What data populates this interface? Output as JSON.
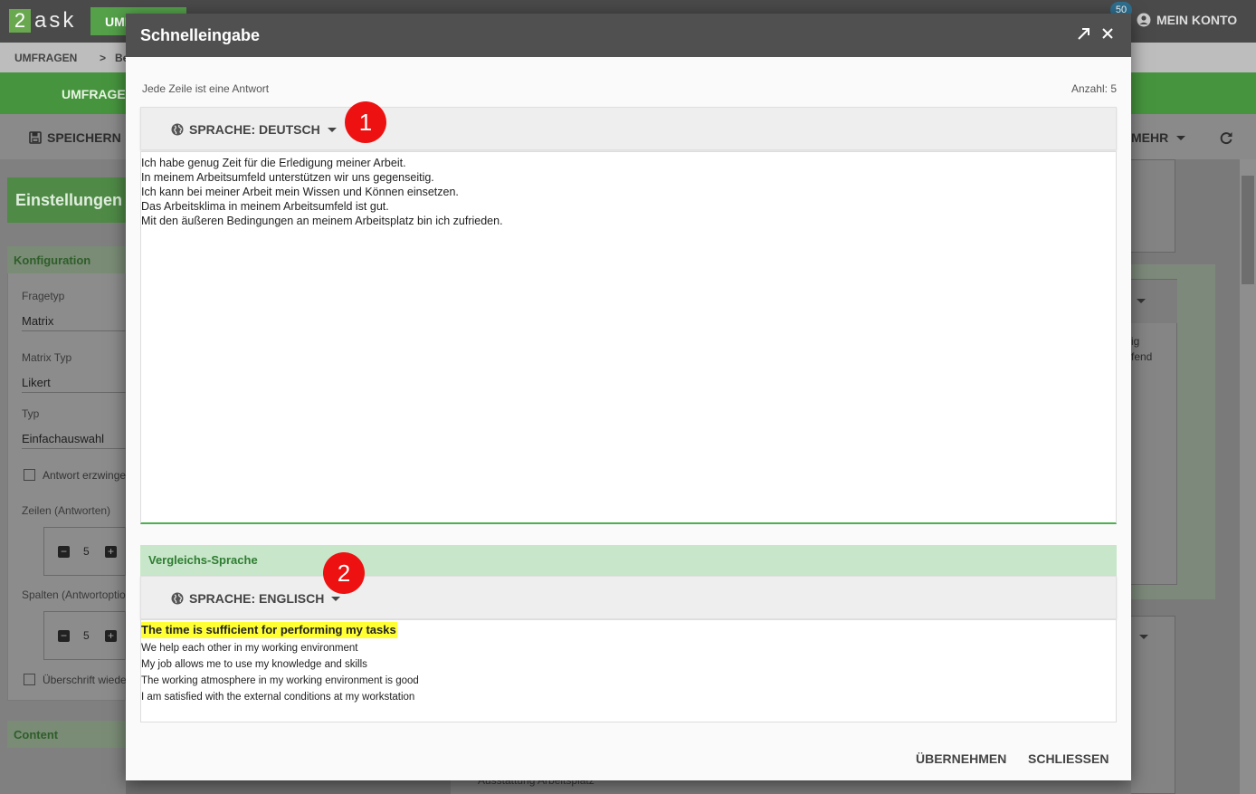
{
  "app": {
    "logo_num": "2",
    "logo_text": "ask",
    "top_tab": "UMF",
    "badge_count": "50",
    "account_label": "MEIN KONTO"
  },
  "breadcrumb": {
    "root": "UMFRAGEN",
    "sep": ">",
    "next": "Be"
  },
  "greenbar": {
    "label": "UMFRAGE"
  },
  "toolbar": {
    "save_label": "SPEICHERN",
    "more_label": "MEHR"
  },
  "left_panel": {
    "title": "Einstellungen",
    "section": "Konfiguration",
    "fields": [
      {
        "label": "Fragetyp",
        "value": "Matrix"
      },
      {
        "label": "Matrix Typ",
        "value": "Likert"
      },
      {
        "label": "Typ",
        "value": "Einfachauswahl"
      }
    ],
    "check_answer": "Antwort erzwinge",
    "rows_label": "Zeilen (Antworten)",
    "rows_value": "5",
    "cols_label": "Spalten (Antwortoptio",
    "cols_value": "5",
    "check_header": "Überschrift wiede",
    "content_section": "Content"
  },
  "right_panel": {
    "text1": "ig",
    "text2": "fend"
  },
  "bottom_strip": "Ausstattung Arbeitsplatz",
  "modal": {
    "title": "Schnelleingabe",
    "hint": "Jede Zeile ist eine Antwort",
    "count": "Anzahl: 5",
    "language_primary": "SPRACHE: DEUTSCH",
    "lines": [
      "Ich habe genug Zeit für die Erledigung meiner Arbeit.",
      "In meinem Arbeitsumfeld unterstützen wir uns gegenseitig.",
      "Ich kann bei meiner Arbeit mein Wissen und Können einsetzen.",
      "Das Arbeitsklima in meinem Arbeitsumfeld ist gut.",
      "Mit den äußeren Bedingungen an meinem Arbeitsplatz bin ich zufrieden."
    ],
    "compare_title": "Vergleichs-Sprache",
    "language_compare": "SPRACHE: ENGLISCH",
    "compare_lines": [
      "The time is sufficient for performing my tasks",
      "We help each other in my working environment",
      "My job allows me to use my knowledge and skills",
      "The working atmosphere in my working environment is good",
      "I am satisfied with the external conditions at my workstation"
    ],
    "apply_label": "ÜBERNEHMEN",
    "close_label": "SCHLIESSEN",
    "marker_1": "1",
    "marker_2": "2"
  }
}
